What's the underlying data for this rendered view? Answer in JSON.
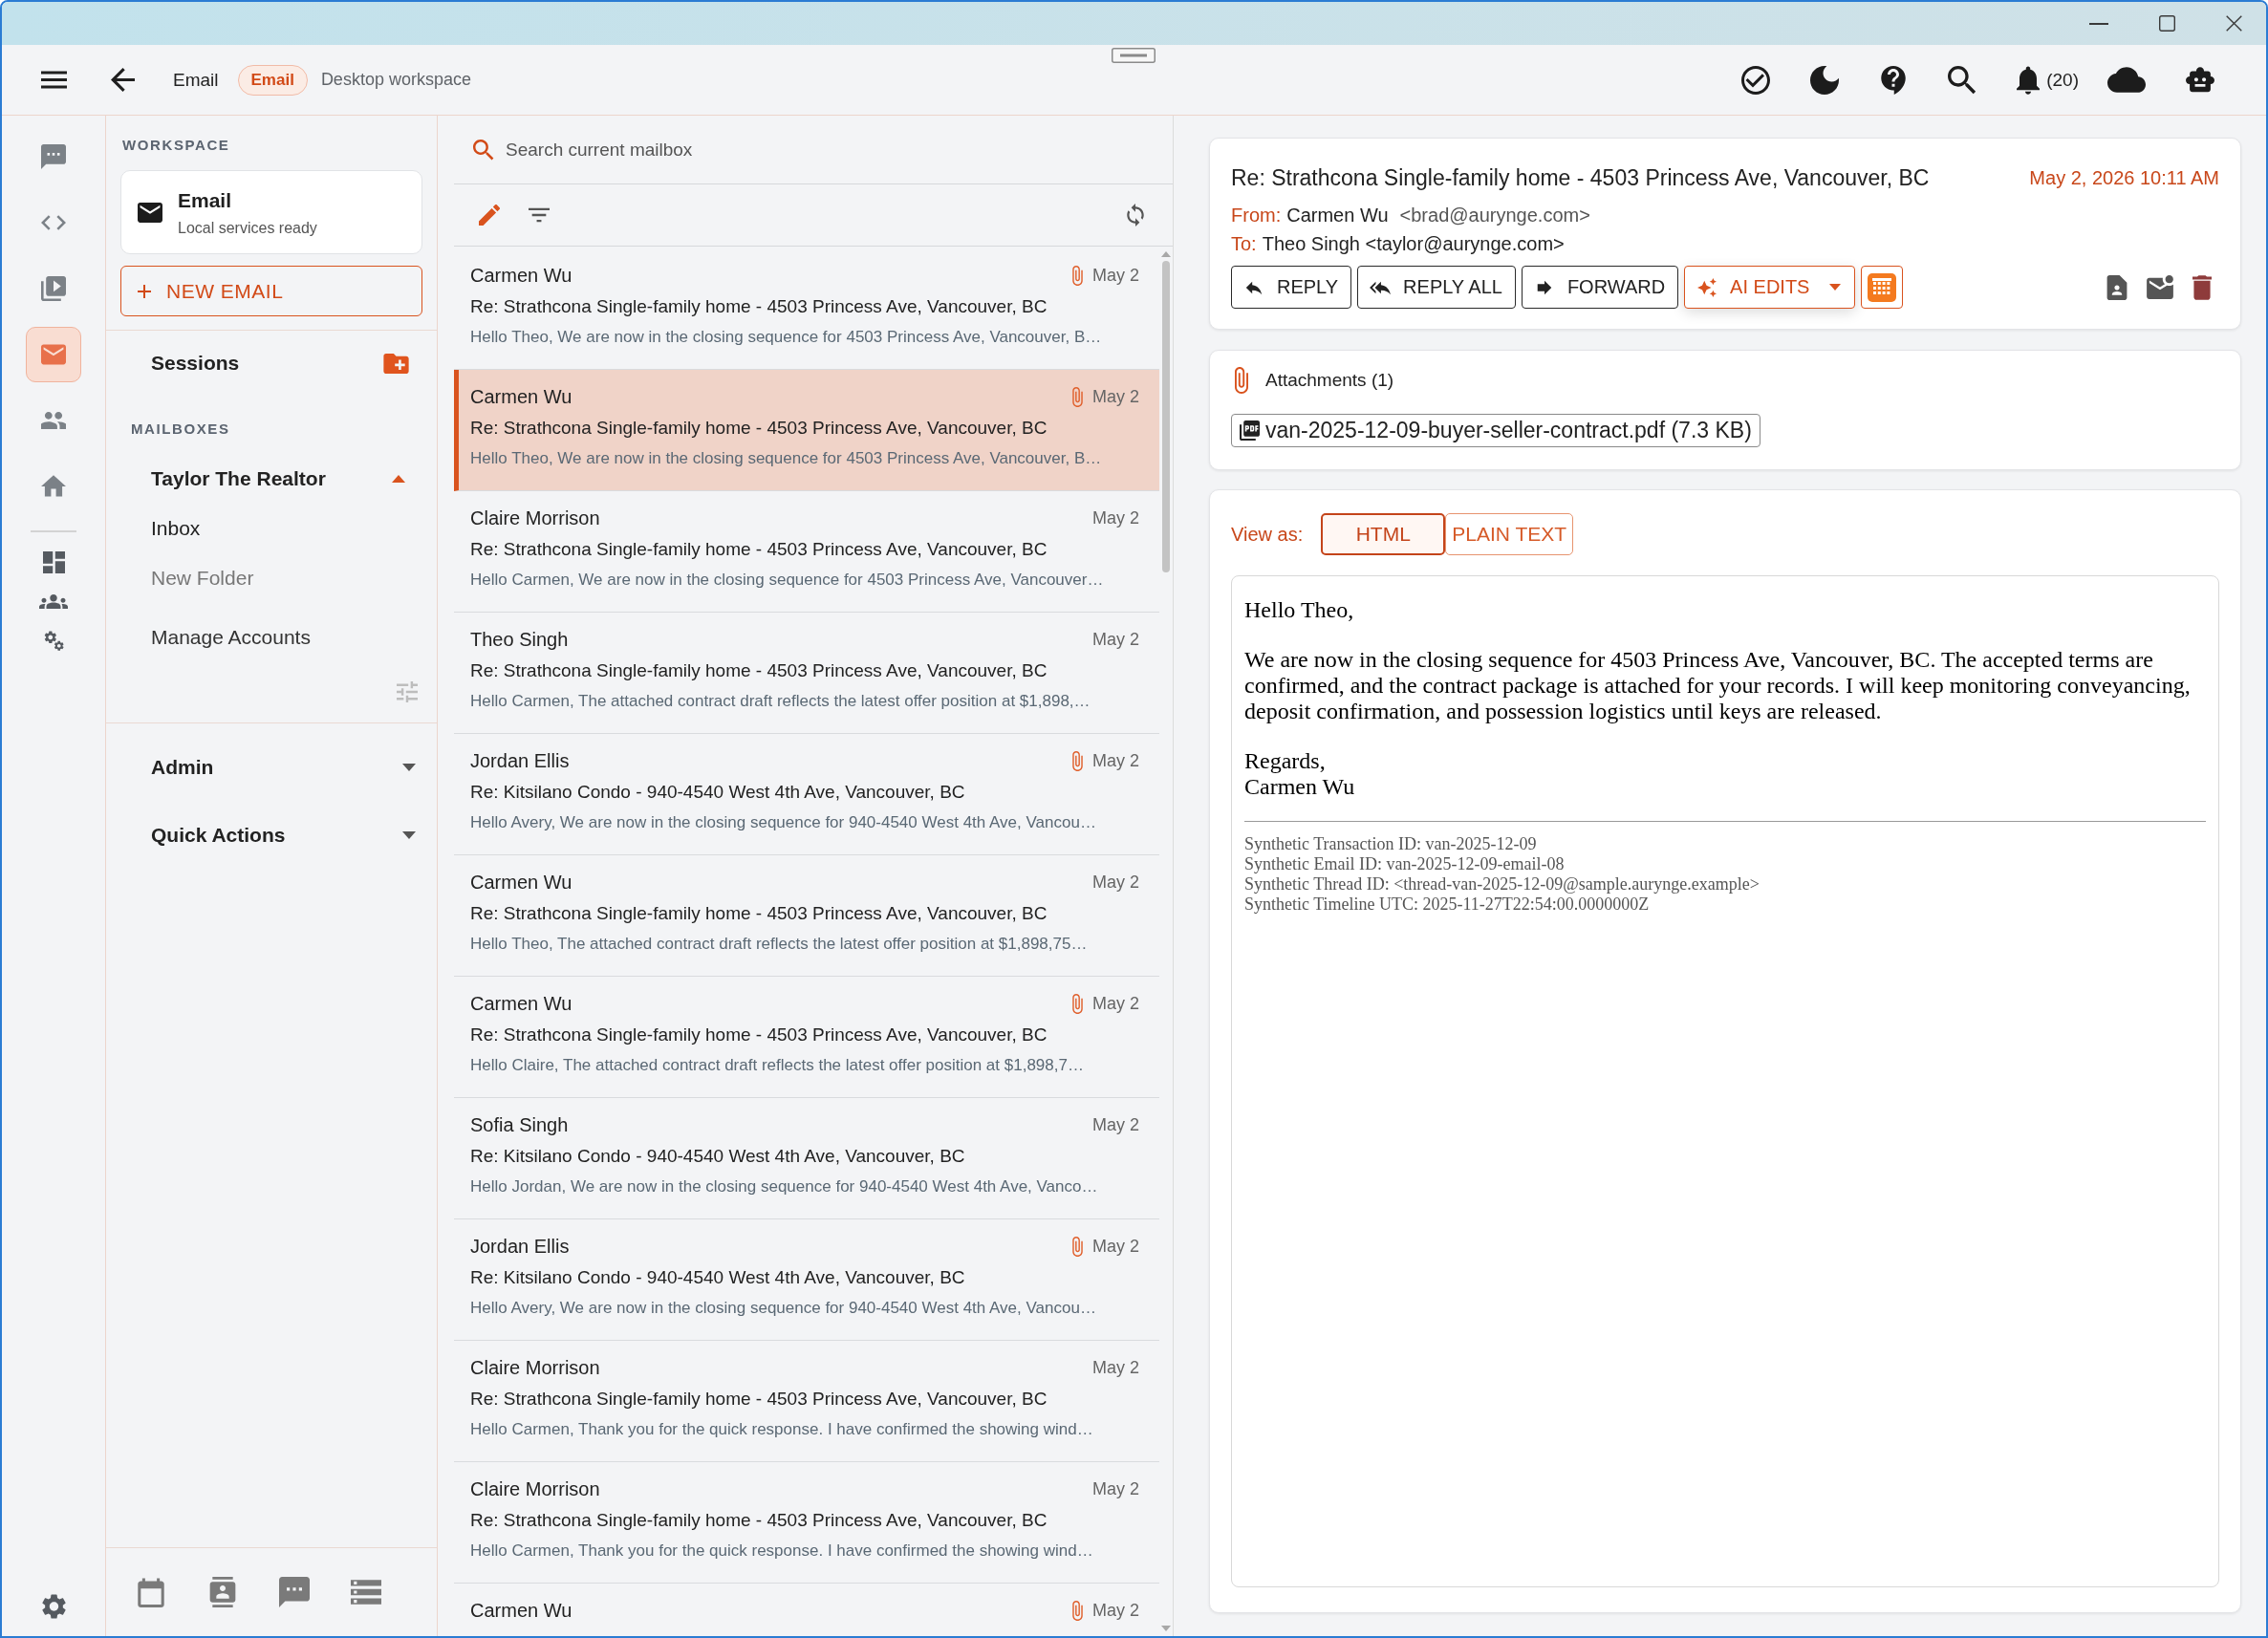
{
  "top_bar": {
    "breadcrumb": "Email",
    "badge": "Email",
    "context": "Desktop workspace",
    "notification_count": "(20)"
  },
  "rail": {
    "items": [
      {
        "selected": false
      },
      {
        "selected": false
      },
      {
        "selected": false
      },
      {
        "selected": true
      },
      {
        "selected": false
      },
      {
        "selected": false
      }
    ]
  },
  "sidebar": {
    "workspace_label": "WORKSPACE",
    "workspace_card": {
      "title": "Email",
      "status": "Local services ready"
    },
    "new_button": "NEW EMAIL",
    "sessions": "Sessions",
    "mailboxes_label": "MAILBOXES",
    "account": {
      "name": "Taylor The Realtor",
      "expanded": true,
      "items": [
        {
          "label": "Inbox",
          "kind": "folder"
        },
        {
          "label": "New Folder",
          "kind": "create"
        },
        {
          "label": "Manage Accounts",
          "kind": "manage"
        }
      ]
    },
    "sections": [
      {
        "label": "Admin",
        "expanded": false
      },
      {
        "label": "Quick Actions",
        "expanded": false
      }
    ]
  },
  "mail_list": {
    "search": {
      "placeholder": "Search current mailbox"
    },
    "messages": [
      {
        "sender": "Carmen Wu",
        "date": "May 2",
        "attachment": true,
        "selected": false,
        "subject": "Re: Strathcona Single-family home - 4503 Princess Ave, Vancouver, BC",
        "preview": "Hello Theo, We are now in the closing sequence for 4503 Princess Ave, Vancouver, B…"
      },
      {
        "sender": "Carmen Wu",
        "date": "May 2",
        "attachment": true,
        "selected": true,
        "subject": "Re: Strathcona Single-family home - 4503 Princess Ave, Vancouver, BC",
        "preview": "Hello Theo, We are now in the closing sequence for 4503 Princess Ave, Vancouver, B…"
      },
      {
        "sender": "Claire Morrison",
        "date": "May 2",
        "attachment": false,
        "selected": false,
        "subject": "Re: Strathcona Single-family home - 4503 Princess Ave, Vancouver, BC",
        "preview": "Hello Carmen, We are now in the closing sequence for 4503 Princess Ave, Vancouver…"
      },
      {
        "sender": "Theo Singh",
        "date": "May 2",
        "attachment": false,
        "selected": false,
        "subject": "Re: Strathcona Single-family home - 4503 Princess Ave, Vancouver, BC",
        "preview": "Hello Carmen, The attached contract draft reflects the latest offer position at $1,898,…"
      },
      {
        "sender": "Jordan Ellis",
        "date": "May 2",
        "attachment": true,
        "selected": false,
        "subject": "Re: Kitsilano Condo - 940-4540 West 4th Ave, Vancouver, BC",
        "preview": "Hello Avery, We are now in the closing sequence for 940-4540 West 4th Ave, Vancou…"
      },
      {
        "sender": "Carmen Wu",
        "date": "May 2",
        "attachment": false,
        "selected": false,
        "subject": "Re: Strathcona Single-family home - 4503 Princess Ave, Vancouver, BC",
        "preview": "Hello Theo, The attached contract draft reflects the latest offer position at $1,898,75…"
      },
      {
        "sender": "Carmen Wu",
        "date": "May 2",
        "attachment": true,
        "selected": false,
        "subject": "Re: Strathcona Single-family home - 4503 Princess Ave, Vancouver, BC",
        "preview": "Hello Claire, The attached contract draft reflects the latest offer position at $1,898,7…"
      },
      {
        "sender": "Sofia Singh",
        "date": "May 2",
        "attachment": false,
        "selected": false,
        "subject": "Re: Kitsilano Condo - 940-4540 West 4th Ave, Vancouver, BC",
        "preview": "Hello Jordan, We are now in the closing sequence for 940-4540 West 4th Ave, Vanco…"
      },
      {
        "sender": "Jordan Ellis",
        "date": "May 2",
        "attachment": true,
        "selected": false,
        "subject": "Re: Kitsilano Condo - 940-4540 West 4th Ave, Vancouver, BC",
        "preview": "Hello Avery, We are now in the closing sequence for 940-4540 West 4th Ave, Vancou…"
      },
      {
        "sender": "Claire Morrison",
        "date": "May 2",
        "attachment": false,
        "selected": false,
        "subject": "Re: Strathcona Single-family home - 4503 Princess Ave, Vancouver, BC",
        "preview": "Hello Carmen, Thank you for the quick response. I have confirmed the showing wind…"
      },
      {
        "sender": "Claire Morrison",
        "date": "May 2",
        "attachment": false,
        "selected": false,
        "subject": "Re: Strathcona Single-family home - 4503 Princess Ave, Vancouver, BC",
        "preview": "Hello Carmen, Thank you for the quick response. I have confirmed the showing wind…"
      },
      {
        "sender": "Carmen Wu",
        "date": "May 2",
        "attachment": true,
        "selected": false
      }
    ]
  },
  "reader": {
    "subject": "Re: Strathcona Single-family home - 4503 Princess Ave, Vancouver, BC",
    "date": "May 2, 2026 10:11 AM",
    "from_label": "From:",
    "from_name": "Carmen Wu",
    "from_address": "<brad@aurynge.com>",
    "to_label": "To:",
    "to": "Theo Singh <taylor@aurynge.com>",
    "actions": [
      {
        "label": "REPLY",
        "kind": "outline"
      },
      {
        "label": "REPLY ALL",
        "kind": "outline"
      },
      {
        "label": "FORWARD",
        "kind": "outline"
      },
      {
        "label": "AI EDITS",
        "kind": "menu"
      }
    ],
    "attachments": {
      "title": "Attachments (1)",
      "files": [
        "van-2025-12-09-buyer-seller-contract.pdf (7.3 KB)"
      ]
    },
    "view": {
      "label": "View as:",
      "options": [
        {
          "label": "HTML",
          "selected": true
        },
        {
          "label": "PLAIN TEXT",
          "selected": false
        }
      ]
    },
    "body": {
      "greeting": "Hello Theo,",
      "paragraph": "We are now in the closing sequence for 4503 Princess Ave, Vancouver, BC. The accepted terms are confirmed, and the contract package is attached for your records. I will keep monitoring conveyancing, deposit confirmation, and possession logistics until keys are released.",
      "closing": "Regards,",
      "signature": "Carmen Wu",
      "footer": [
        "Synthetic Transaction ID: van-2025-12-09",
        "Synthetic Email ID: van-2025-12-09-email-08",
        "Synthetic Thread ID: <thread-van-2025-12-09@sample.aurynge.example>",
        "Synthetic Timeline UTC: 2025-11-27T22:54:00.0000000Z"
      ]
    }
  }
}
